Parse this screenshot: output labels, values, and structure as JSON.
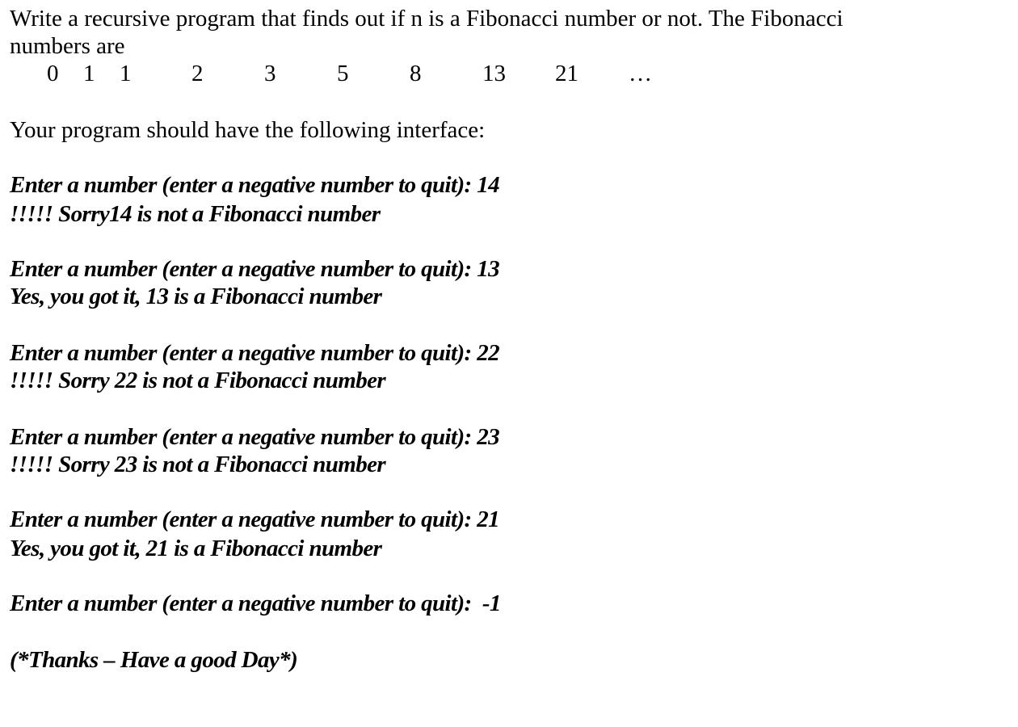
{
  "intro": {
    "line1": "Write a recursive program that finds out if n is a Fibonacci number or not. The Fibonacci",
    "line2": "numbers are"
  },
  "fibonacci_sequence": [
    "0",
    "1",
    "1",
    "2",
    "3",
    "5",
    "8",
    "13",
    "21",
    "…"
  ],
  "interface_heading": "Your program should have the following interface:",
  "sessions": [
    {
      "prompt": "Enter a number (enter a negative number to quit): 14",
      "response": "!!!!! Sorry14 is not a Fibonacci number"
    },
    {
      "prompt": "Enter a number (enter a negative number to quit): 13",
      "response": "Yes, you got it, 13 is a Fibonacci number"
    },
    {
      "prompt": "Enter a number (enter a negative number to quit): 22",
      "response": "!!!!! Sorry 22 is not a Fibonacci number"
    },
    {
      "prompt": "Enter a number (enter a negative number to quit): 23",
      "response": "!!!!! Sorry 23 is not a Fibonacci number"
    },
    {
      "prompt": "Enter a number (enter a negative number to quit): 21",
      "response": "Yes, you got it, 21 is a Fibonacci number"
    }
  ],
  "quit_prompt": "Enter a number (enter a negative number to quit):  -1",
  "farewell": "(*Thanks – Have a good Day*)"
}
